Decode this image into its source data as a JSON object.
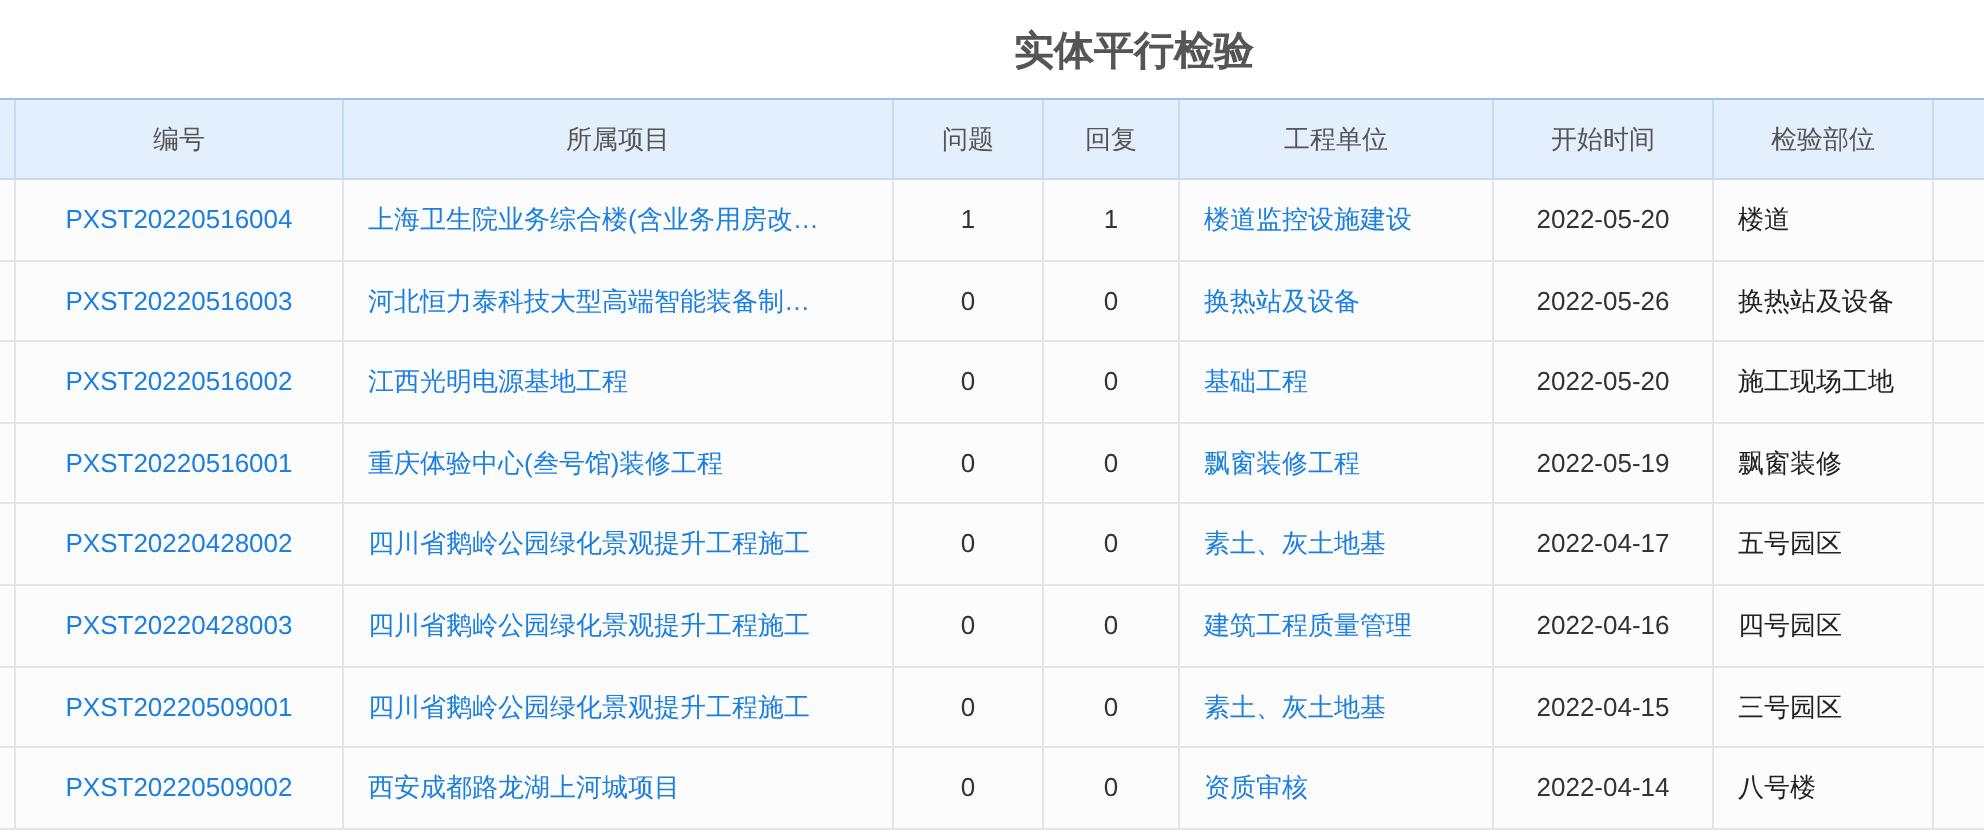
{
  "title": "实体平行检验",
  "table": {
    "columns": [
      "编号",
      "所属项目",
      "问题",
      "回复",
      "工程单位",
      "开始时间",
      "检验部位"
    ],
    "rows": [
      {
        "cells": [
          "PXST20220516004",
          "上海卫生院业务综合楼(含业务用房改…",
          "1",
          "1",
          "楼道监控设施建设",
          "2022-05-20",
          "楼道"
        ]
      },
      {
        "cells": [
          "PXST20220516003",
          "河北恒力泰科技大型高端智能装备制…",
          "0",
          "0",
          "换热站及设备",
          "2022-05-26",
          "换热站及设备"
        ]
      },
      {
        "cells": [
          "PXST20220516002",
          "江西光明电源基地工程",
          "0",
          "0",
          "基础工程",
          "2022-05-20",
          "施工现场工地"
        ]
      },
      {
        "cells": [
          "PXST20220516001",
          "重庆体验中心(叁号馆)装修工程",
          "0",
          "0",
          "飘窗装修工程",
          "2022-05-19",
          "飘窗装修"
        ]
      },
      {
        "cells": [
          "PXST20220428002",
          "四川省鹅岭公园绿化景观提升工程施工",
          "0",
          "0",
          "素土、灰土地基",
          "2022-04-17",
          "五号园区"
        ]
      },
      {
        "cells": [
          "PXST20220428003",
          "四川省鹅岭公园绿化景观提升工程施工",
          "0",
          "0",
          "建筑工程质量管理",
          "2022-04-16",
          "四号园区"
        ]
      },
      {
        "cells": [
          "PXST20220509001",
          "四川省鹅岭公园绿化景观提升工程施工",
          "0",
          "0",
          "素土、灰土地基",
          "2022-04-15",
          "三号园区"
        ]
      },
      {
        "cells": [
          "PXST20220509002",
          "西安成都路龙湖上河城项目",
          "0",
          "0",
          "资质审核",
          "2022-04-14",
          "八号楼"
        ]
      }
    ]
  }
}
